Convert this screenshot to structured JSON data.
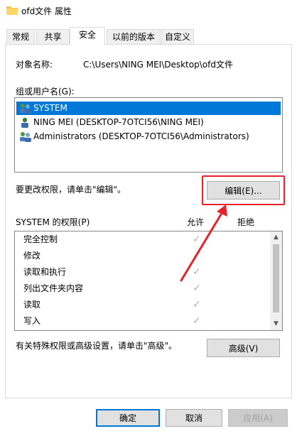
{
  "window": {
    "title": "ofd文件 属性",
    "folder_icon": "folder-icon"
  },
  "tabs": [
    {
      "label": "常规",
      "active": false
    },
    {
      "label": "共享",
      "active": false
    },
    {
      "label": "安全",
      "active": true
    },
    {
      "label": "以前的版本",
      "active": false
    },
    {
      "label": "自定义",
      "active": false
    }
  ],
  "security": {
    "object_name_label": "对象名称:",
    "object_name_value": "C:\\Users\\NING MEI\\Desktop\\ofd文件",
    "groups_label": "组或用户名(G):",
    "users": [
      {
        "name": "SYSTEM",
        "icon": "group-icon",
        "selected": true
      },
      {
        "name": "NING MEI (DESKTOP-7OTCI56\\NING MEI)",
        "icon": "user-icon",
        "selected": false
      },
      {
        "name": "Administrators (DESKTOP-7OTCI56\\Administrators)",
        "icon": "group-icon",
        "selected": false
      }
    ],
    "edit_hint": "要更改权限，请单击\"编辑\"。",
    "edit_button": "编辑(E)...",
    "perm_label": "SYSTEM 的权限(P)",
    "allow_header": "允许",
    "deny_header": "拒绝",
    "permissions": [
      {
        "name": "完全控制",
        "allow": "✓"
      },
      {
        "name": "修改",
        "allow": "✓"
      },
      {
        "name": "读取和执行",
        "allow": "✓"
      },
      {
        "name": "列出文件夹内容",
        "allow": "✓"
      },
      {
        "name": "读取",
        "allow": "✓"
      },
      {
        "name": "写入",
        "allow": "✓"
      }
    ],
    "advanced_hint": "有关特殊权限或高级设置，请单击\"高级\"。",
    "advanced_button": "高级(V)"
  },
  "footer": {
    "ok": "确定",
    "cancel": "取消",
    "apply": "应用(A)"
  },
  "colors": {
    "selection": "#0078d7",
    "annotation": "#e8222a"
  }
}
